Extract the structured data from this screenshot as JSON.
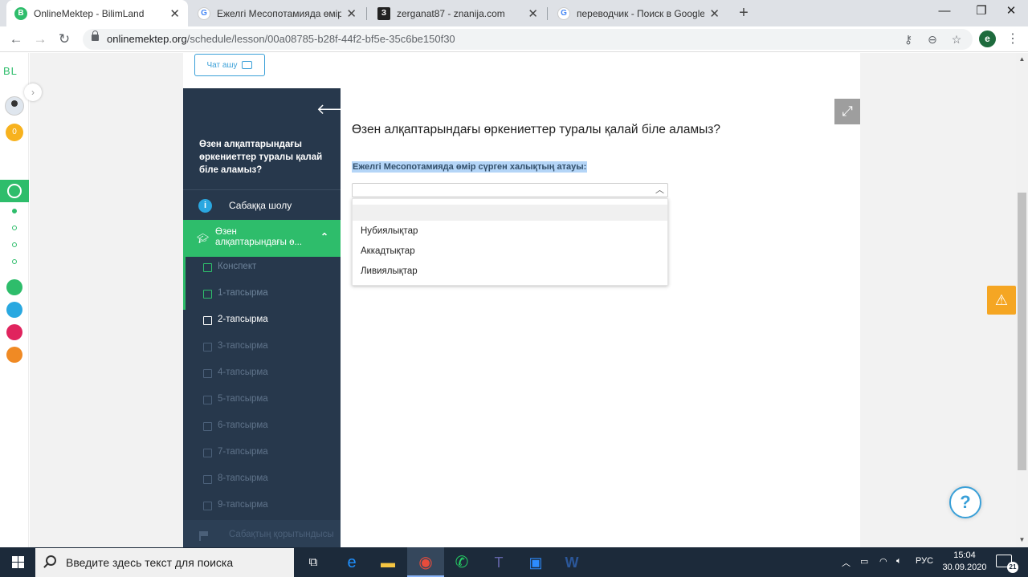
{
  "browser": {
    "tabs": [
      {
        "title": "OnlineMektep - BilimLand",
        "active": true,
        "icon": "bilimland-icon",
        "color": "#2ebd6b"
      },
      {
        "title": "Ежелгі Месопотамияда өмір сү",
        "active": false,
        "icon": "google-icon",
        "color": "#4285f4"
      },
      {
        "title": "zerganat87 - znanija.com",
        "active": false,
        "icon": "znanija-icon",
        "color": "#222"
      },
      {
        "title": "переводчик - Поиск в Google",
        "active": false,
        "icon": "google-icon",
        "color": "#4285f4"
      }
    ],
    "new_tab": "+",
    "url_host": "onlinemektep.org",
    "url_path": "/schedule/lesson/00a08785-b28f-44f2-bf5e-35c6be150f30",
    "profile_letter": "e"
  },
  "rail": {
    "logo": "BL",
    "coins": "0"
  },
  "lesson": {
    "chat_button": "Чат ашу",
    "sidebar_title": "Өзен алқаптарындағы өркениеттер туралы қалай біле аламыз?",
    "overview_label": "Сабаққа шолу",
    "active_section": "Өзен алқаптарындағы ө...",
    "active_section_line1": "Өзен",
    "active_section_line2": "алқаптарындағы ө...",
    "items": [
      {
        "label": "Конспект",
        "state": "done"
      },
      {
        "label": "1-тапсырма",
        "state": "done"
      },
      {
        "label": "2-тапсырма",
        "state": "current"
      },
      {
        "label": "3-тапсырма",
        "state": "locked"
      },
      {
        "label": "4-тапсырма",
        "state": "locked"
      },
      {
        "label": "5-тапсырма",
        "state": "locked"
      },
      {
        "label": "6-тапсырма",
        "state": "locked"
      },
      {
        "label": "7-тапсырма",
        "state": "locked"
      },
      {
        "label": "8-тапсырма",
        "state": "locked"
      },
      {
        "label": "9-тапсырма",
        "state": "locked"
      }
    ],
    "bottom_label": "Сабақтың қорытындысы"
  },
  "question": {
    "title": "Өзен алқаптарындағы өркениеттер туралы қалай біле аламыз?",
    "prompt": "Ежелгі Месопотамияда өмір сүрген халықтың атауы:",
    "selected_value": "",
    "options": [
      "",
      "Нубиялықтар",
      "Аккадтықтар",
      "Ливиялықтар"
    ]
  },
  "help_label": "?",
  "taskbar": {
    "search_placeholder": "Введите здесь текст для поиска",
    "language": "РУС",
    "time": "15:04",
    "date": "30.09.2020",
    "notifications": "21"
  }
}
